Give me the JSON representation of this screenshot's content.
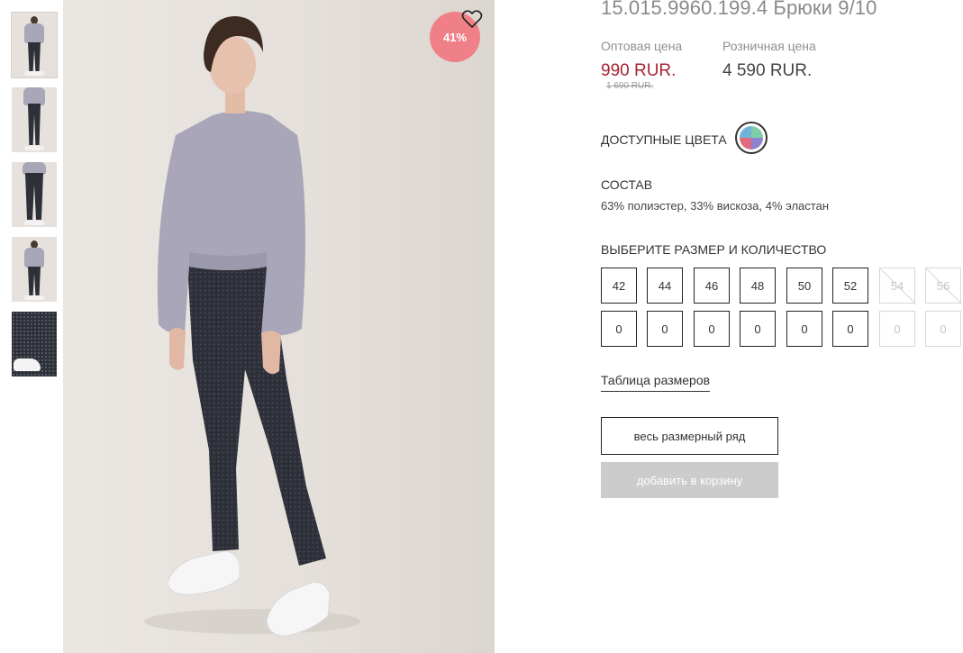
{
  "product": {
    "title": "15.015.9960.199.4 Брюки 9/10",
    "discount_badge": "41%",
    "wholesale_label": "Оптовая цена",
    "wholesale_price": "990 RUR.",
    "old_price": "1 690 RUR.",
    "retail_label": "Розничная цена",
    "retail_price": "4 590 RUR."
  },
  "colors": {
    "label": "ДОСТУПНЫЕ ЦВЕТА"
  },
  "composition": {
    "label": "СОСТАВ",
    "value": "63% полиэстер, 33% вискоза, 4% эластан"
  },
  "sizes": {
    "label": "ВЫБЕРИТЕ РАЗМЕР И КОЛИЧЕСТВО",
    "items": [
      {
        "size": "42",
        "qty": "0"
      },
      {
        "size": "44",
        "qty": "0"
      },
      {
        "size": "46",
        "qty": "0"
      },
      {
        "size": "48",
        "qty": "0"
      },
      {
        "size": "50",
        "qty": "0"
      },
      {
        "size": "52",
        "qty": "0"
      },
      {
        "size": "54",
        "qty": "0"
      },
      {
        "size": "56",
        "qty": "0"
      }
    ]
  },
  "size_table_link": "Таблица размеров",
  "buttons": {
    "all_sizes": "весь размерный ряд",
    "add_to_cart": "добавить в корзину"
  },
  "icons": {
    "favorite": "heart-icon",
    "color_swatch": "multicolor-swatch"
  },
  "accent_colors": {
    "price": "#a5242f",
    "badge": "#f08088",
    "cart_button": "#cccccc"
  }
}
